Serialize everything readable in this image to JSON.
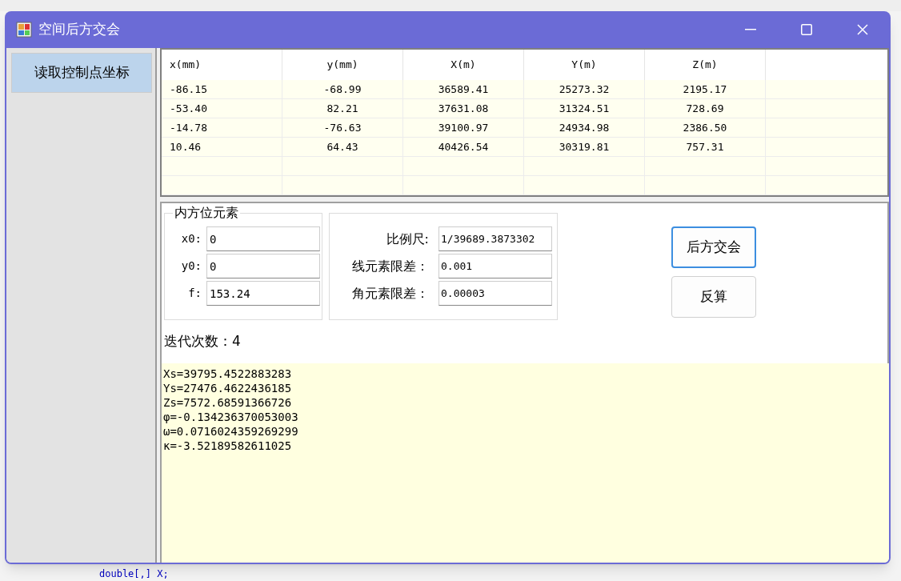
{
  "ide": {
    "code_lines": [
      "double[,] X;"
    ]
  },
  "window": {
    "title": "空间后方交会"
  },
  "sidebar": {
    "buttons": [
      {
        "label": "读取控制点坐标"
      }
    ]
  },
  "table": {
    "columns": [
      "x(mm)",
      "y(mm)",
      "X(m)",
      "Y(m)",
      "Z(m)"
    ],
    "rows": [
      [
        "-86.15",
        "-68.99",
        "36589.41",
        "25273.32",
        "2195.17"
      ],
      [
        "-53.40",
        "82.21",
        "37631.08",
        "31324.51",
        "728.69"
      ],
      [
        "-14.78",
        "-76.63",
        "39100.97",
        "24934.98",
        "2386.50"
      ],
      [
        "10.46",
        "64.43",
        "40426.54",
        "30319.81",
        "757.31"
      ]
    ]
  },
  "interior": {
    "title": "内方位元素",
    "fields": [
      {
        "label": "x0:",
        "value": "0"
      },
      {
        "label": "y0:",
        "value": "0"
      },
      {
        "label": "f:",
        "value": "153.24"
      }
    ]
  },
  "tolerances": {
    "fields": [
      {
        "label": "比例尺:",
        "value": "1/39689.3873302"
      },
      {
        "label": "线元素限差：",
        "value": "0.001"
      },
      {
        "label": "角元素限差：",
        "value": "0.00003"
      }
    ]
  },
  "buttons": [
    {
      "label": "后方交会",
      "focused": true
    },
    {
      "label": "反算",
      "focused": false
    }
  ],
  "iterations": "迭代次数：4",
  "output": {
    "lines": [
      "Xs=39795.4522883283",
      "Ys=27476.4622436185",
      "Zs=7572.68591366726",
      "φ=-0.134236370053003",
      "ω=0.0716024359269299",
      "κ=-3.52189582611025"
    ]
  }
}
